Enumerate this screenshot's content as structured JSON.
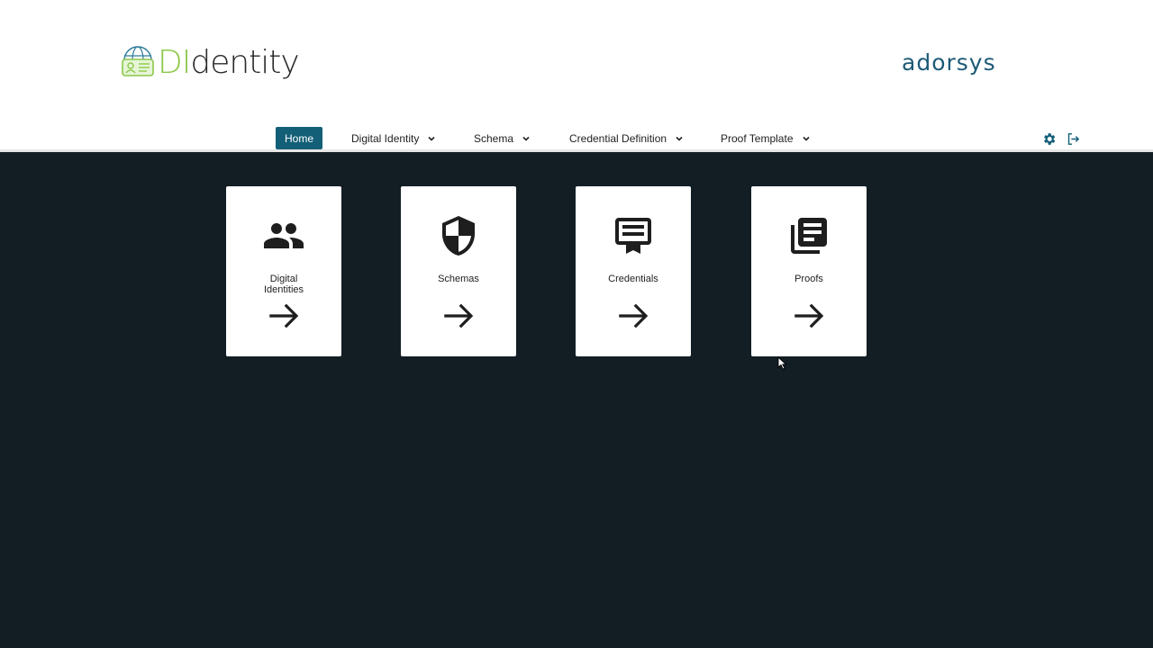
{
  "header": {
    "logo": {
      "text_di": "DI",
      "text_rest": "dentity",
      "icon": "id-card-globe-icon"
    },
    "brand": "adorsys",
    "colors": {
      "brand": "#1d5a77",
      "logo_green": "#8cc84b",
      "accent": "#135f78",
      "page_bg": "#131e24"
    }
  },
  "nav": {
    "items": [
      {
        "label": "Home",
        "active": true
      },
      {
        "label": "Digital Identity",
        "dropdown": true
      },
      {
        "label": "Schema",
        "dropdown": true
      },
      {
        "label": "Credential Definition",
        "dropdown": true
      },
      {
        "label": "Proof Template",
        "dropdown": true
      }
    ],
    "tools": [
      {
        "icon": "gear-icon"
      },
      {
        "icon": "logout-icon"
      }
    ]
  },
  "cards": [
    {
      "label": "Digital Identities",
      "icon": "users-icon"
    },
    {
      "label": "Schemas",
      "icon": "shield-icon"
    },
    {
      "label": "Credentials",
      "icon": "certificate-icon"
    },
    {
      "label": "Proofs",
      "icon": "document-stack-icon"
    }
  ]
}
